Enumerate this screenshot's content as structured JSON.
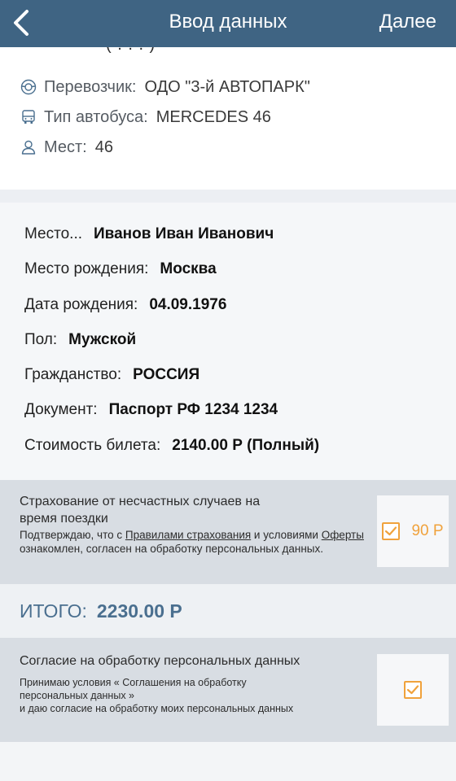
{
  "header": {
    "title": "Ввод данных",
    "next_label": "Далее"
  },
  "trip": {
    "cut_text": "(  .  .  .  )",
    "carrier": {
      "icon": "steering-wheel-icon",
      "label": "Перевозчик:",
      "value": "ОДО \"3-й АВТОПАРК\""
    },
    "bus_type": {
      "icon": "bus-icon",
      "label": "Тип автобуса:",
      "value": "MERCEDES 46"
    },
    "seats": {
      "icon": "person-icon",
      "label": "Мест:",
      "value": "46"
    }
  },
  "passenger": {
    "seat": {
      "label": "Место...",
      "value": "Иванов Иван Иванович"
    },
    "birthplace": {
      "label": "Место рождения:",
      "value": "Москва"
    },
    "birthdate": {
      "label": "Дата рождения:",
      "value": "04.09.1976"
    },
    "gender": {
      "label": "Пол:",
      "value": "Мужской"
    },
    "citizenship": {
      "label": "Гражданство:",
      "value": "РОССИЯ"
    },
    "document": {
      "label": "Документ:",
      "value": "Паспорт РФ 1234 1234"
    },
    "price": {
      "label": "Стоимость билета:",
      "value": "2140.00 Р (Полный)"
    }
  },
  "insurance": {
    "title": "Страхование от несчастных случаев на время поездки",
    "text_part1": "Подтверждаю, что с ",
    "rules_link": "Правилами страхования",
    "text_part2": " и условиями ",
    "offer_link": "Оферты",
    "text_part3": " ознакомлен, согласен на обработку персональных данных.",
    "checked": true,
    "price": "90 Р"
  },
  "total": {
    "label": "ИТОГО:",
    "value": "2230.00 Р"
  },
  "consent": {
    "title": "Согласие на обработку персональных данных",
    "line1": "Принимаю условия « Соглашения на обработку",
    "line2": "персональных данных »",
    "line3": "и даю согласие на обработку моих персональных данных",
    "checked": true
  },
  "colors": {
    "header": "#3f6483",
    "accent": "#f0a23c",
    "total_text": "#4a6f8f"
  }
}
